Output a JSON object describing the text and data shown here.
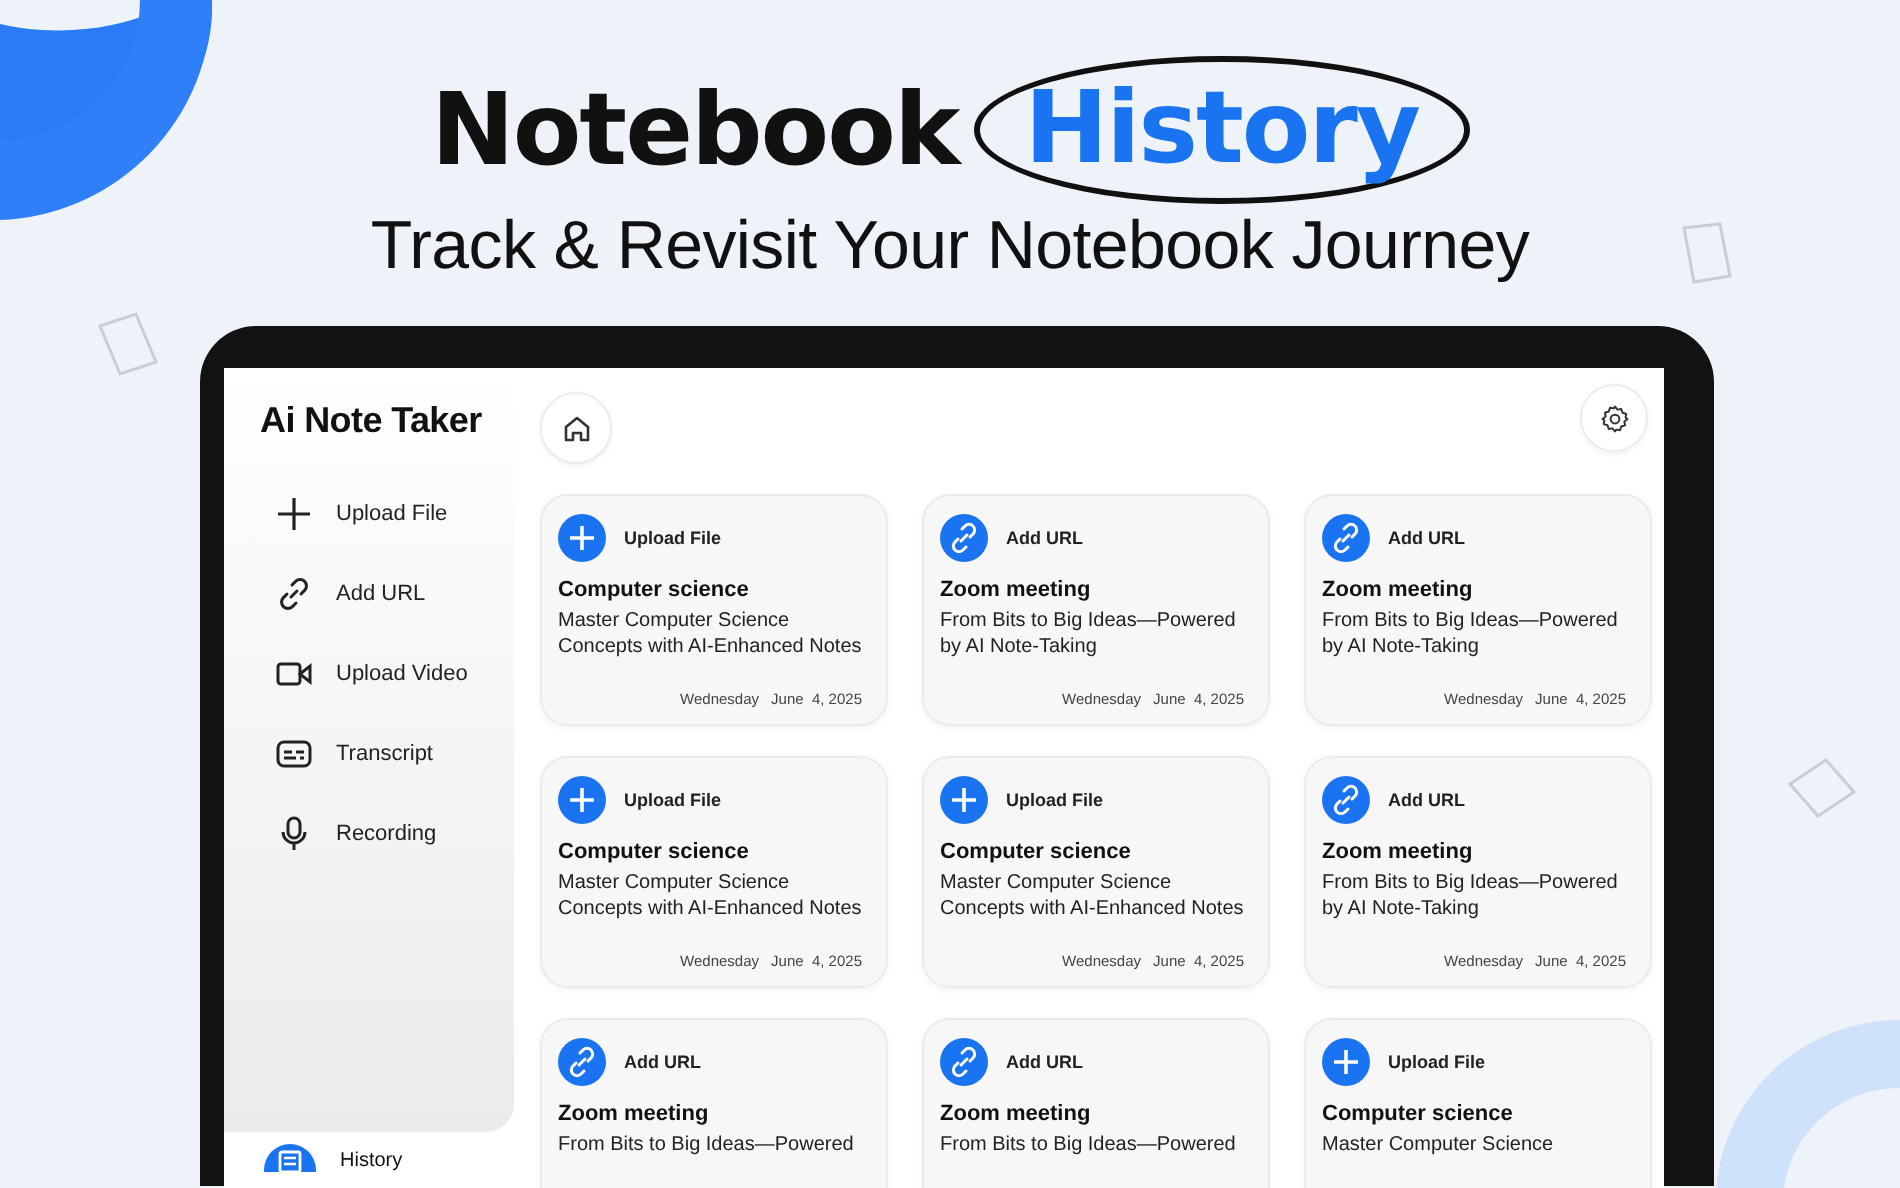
{
  "headline": {
    "title": "Notebook",
    "highlight": "History",
    "subtitle": "Track & Revisit Your Notebook Journey"
  },
  "app": {
    "title": "Ai Note Taker",
    "sidebar": {
      "items": [
        {
          "kind": "upload",
          "label": "Upload File"
        },
        {
          "kind": "link",
          "label": "Add URL"
        },
        {
          "kind": "video",
          "label": "Upload Video"
        },
        {
          "kind": "transcript",
          "label": "Transcript"
        },
        {
          "kind": "mic",
          "label": "Recording"
        }
      ],
      "history": {
        "label": "History"
      }
    },
    "cards": [
      {
        "kind": "file",
        "source": "Upload File",
        "title": "Computer science",
        "description": "Master Computer Science Concepts with AI-Enhanced Notes",
        "day": "Wednesday",
        "date": "June  4, 2025"
      },
      {
        "kind": "url",
        "source": "Add URL",
        "title": "Zoom meeting",
        "description": "From Bits to Big Ideas—Powered by AI Note-Taking",
        "day": "Wednesday",
        "date": "June  4, 2025"
      },
      {
        "kind": "url",
        "source": "Add URL",
        "title": "Zoom meeting",
        "description": "From Bits to Big Ideas—Powered by AI Note-Taking",
        "day": "Wednesday",
        "date": "June  4, 2025"
      },
      {
        "kind": "file",
        "source": "Upload File",
        "title": "Computer science",
        "description": "Master Computer Science Concepts with AI-Enhanced Notes",
        "day": "Wednesday",
        "date": "June  4, 2025"
      },
      {
        "kind": "file",
        "source": "Upload File",
        "title": "Computer science",
        "description": "Master Computer Science Concepts with AI-Enhanced Notes",
        "day": "Wednesday",
        "date": "June  4, 2025"
      },
      {
        "kind": "url",
        "source": "Add URL",
        "title": "Zoom meeting",
        "description": "From Bits to Big Ideas—Powered by AI Note-Taking",
        "day": "Wednesday",
        "date": "June  4, 2025"
      },
      {
        "kind": "url",
        "source": "Add URL",
        "title": "Zoom meeting",
        "description": "From Bits to Big Ideas—Powered"
      },
      {
        "kind": "url",
        "source": "Add URL",
        "title": "Zoom meeting",
        "description": "From Bits to Big Ideas—Powered"
      },
      {
        "kind": "file",
        "source": "Upload File",
        "title": "Computer science",
        "description": "Master Computer Science"
      }
    ]
  }
}
